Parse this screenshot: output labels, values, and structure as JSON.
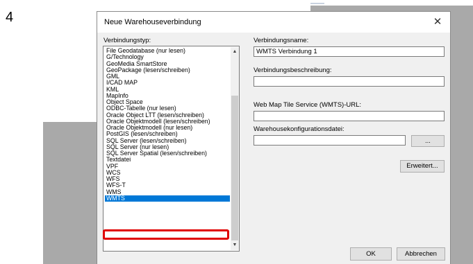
{
  "step_number": "4",
  "dialog": {
    "title": "Neue Warehouseverbindung",
    "close_glyph": "✕"
  },
  "left_panel": {
    "label": "Verbindungstyp:",
    "items": [
      "File Geodatabase (nur lesen)",
      "G/Technology",
      "GeoMedia SmartStore",
      "GeoPackage (lesen/schreiben)",
      "GML",
      "I/CAD MAP",
      "KML",
      "MapInfo",
      "Object Space",
      "ODBC-Tabelle (nur lesen)",
      "Oracle Object LTT (lesen/schreiben)",
      "Oracle Objektmodell (lesen/schreiben)",
      "Oracle Objektmodell (nur lesen)",
      "PostGIS (lesen/schreiben)",
      "SQL Server (lesen/schreiben)",
      "SQL Server (nur lesen)",
      "SQL Server Spatial (lesen/schreiben)",
      "Textdatei",
      "VPF",
      "WCS",
      "WFS",
      "WFS-T",
      "WMS",
      "WMTS"
    ],
    "selected_item": "WMTS",
    "scroll_up_glyph": "▲",
    "scroll_down_glyph": "▼"
  },
  "right_panel": {
    "name_label": "Verbindungsname:",
    "name_value": "WMTS Verbindung 1",
    "description_label": "Verbindungsbeschreibung:",
    "description_value": "",
    "url_label": "Web Map Tile Service (WMTS)-URL:",
    "url_value": "",
    "config_label": "Warehousekonfigurationsdatei:",
    "config_value": "",
    "browse_label": "...",
    "advanced_label": "Erweitert..."
  },
  "footer": {
    "ok_label": "OK",
    "cancel_label": "Abbrechen"
  },
  "colors": {
    "selection": "#0078d7",
    "highlight_outline": "#e00000",
    "background_gray": "#a9a9a9"
  }
}
